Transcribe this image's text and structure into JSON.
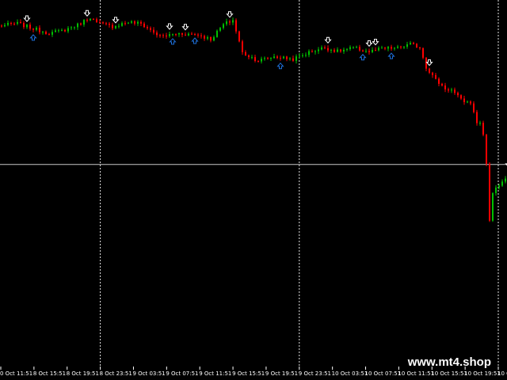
{
  "chart_data": {
    "type": "candlestick",
    "title": "",
    "xlabel": "",
    "ylabel": "",
    "grid": "vertical dotted separators",
    "price_range": [
      0,
      100
    ],
    "horizontal_line_level": 55.8,
    "colors": {
      "bull": "#00c000",
      "bear": "#ff0000",
      "background": "#000000",
      "text": "#ffffff",
      "signal_up": "#1e6fd9",
      "signal_down": "#ffffff"
    },
    "x_tick_labels": [
      "0 Oct 11:51",
      "8 Oct 15:51",
      "8 Oct 19:51",
      "8 Oct 23:51",
      "9 Oct 03:51",
      "9 Oct 07:51",
      "9 Oct 11:51",
      "9 Oct 15:51",
      "9 Oct 19:51",
      "9 Oct 23:51",
      "10 Oct 03:51",
      "10 Oct 07:51",
      "10 Oct 11:51",
      "10 Oct 15:51",
      "10 Oct 19:51",
      "10 Oct 23:5"
    ],
    "separator_labels": [
      "8 Oct 23:51",
      "9 Oct 23:51",
      "10 Oct 23:5"
    ],
    "close_anchors": [
      [
        0,
        93.0
      ],
      [
        6,
        93.7
      ],
      [
        11,
        92.3
      ],
      [
        16,
        91.1
      ],
      [
        20,
        91.7
      ],
      [
        25,
        93.3
      ],
      [
        29,
        95.4
      ],
      [
        31,
        93.8
      ],
      [
        36,
        92.9
      ],
      [
        41,
        94.1
      ],
      [
        45,
        93.6
      ],
      [
        51,
        90.2
      ],
      [
        57,
        91.0
      ],
      [
        63,
        90.7
      ],
      [
        67,
        89.4
      ],
      [
        71,
        93.4
      ],
      [
        74,
        94.6
      ],
      [
        77,
        85.8
      ],
      [
        82,
        83.7
      ],
      [
        87,
        84.8
      ],
      [
        93,
        84.1
      ],
      [
        99,
        86.3
      ],
      [
        103,
        87.2
      ],
      [
        107,
        86.2
      ],
      [
        112,
        87.1
      ],
      [
        117,
        86.1
      ],
      [
        121,
        86.9
      ],
      [
        126,
        87.1
      ],
      [
        130,
        88.1
      ],
      [
        133,
        87.3
      ],
      [
        135,
        82.0
      ],
      [
        138,
        78.5
      ],
      [
        141,
        76.2
      ],
      [
        143,
        75.8
      ],
      [
        146,
        73.1
      ],
      [
        149,
        72.2
      ],
      [
        150,
        69.9
      ],
      [
        151,
        66.9
      ],
      [
        152,
        67.0
      ],
      [
        153,
        63.8
      ],
      [
        154,
        56.0
      ],
      [
        155,
        40.7
      ],
      [
        156,
        48.1
      ],
      [
        157,
        49.6
      ],
      [
        158,
        50.1
      ],
      [
        159,
        51.2
      ],
      [
        160,
        52.0
      ],
      [
        161,
        54.1
      ],
      [
        162,
        55.9
      ]
    ],
    "arrows": [
      {
        "bar": 9,
        "dir": "down"
      },
      {
        "bar": 11,
        "dir": "up"
      },
      {
        "bar": 28,
        "dir": "down"
      },
      {
        "bar": 37,
        "dir": "down"
      },
      {
        "bar": 54,
        "dir": "down"
      },
      {
        "bar": 55,
        "dir": "up"
      },
      {
        "bar": 59,
        "dir": "down"
      },
      {
        "bar": 62,
        "dir": "up"
      },
      {
        "bar": 73,
        "dir": "down"
      },
      {
        "bar": 89,
        "dir": "up"
      },
      {
        "bar": 104,
        "dir": "down"
      },
      {
        "bar": 115,
        "dir": "up"
      },
      {
        "bar": 117,
        "dir": "down"
      },
      {
        "bar": 119,
        "dir": "down"
      },
      {
        "bar": 124,
        "dir": "up"
      },
      {
        "bar": 136,
        "dir": "down"
      },
      {
        "bar": 161,
        "dir": "down"
      }
    ]
  },
  "watermark": "www.mt4.shop"
}
